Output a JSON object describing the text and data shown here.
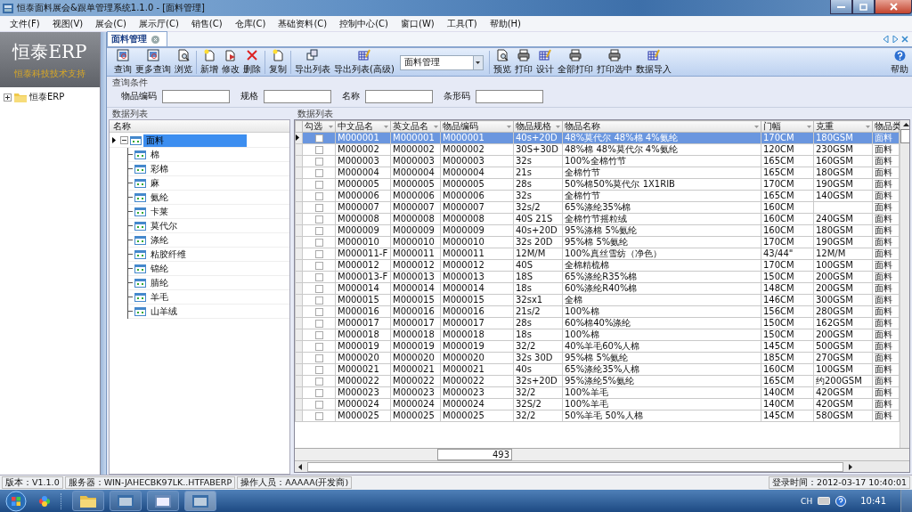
{
  "window": {
    "title": "恒泰面料展会&跟单管理系统1.1.0 - [面料管理]"
  },
  "menu": [
    "文件(F)",
    "视图(V)",
    "展会(C)",
    "展示厅(C)",
    "销售(C)",
    "仓库(C)",
    "基础资料(C)",
    "控制中心(C)",
    "窗口(W)",
    "工具(T)",
    "帮助(H)"
  ],
  "left_panel": {
    "logo": "恒泰ERP",
    "tagline": "恒泰科技技术支持",
    "tree": [
      {
        "label": "恒泰ERP",
        "expanded": false
      }
    ]
  },
  "tabs": [
    {
      "label": "面料管理",
      "selected": true
    }
  ],
  "toolbar": {
    "items": [
      {
        "label": "查询",
        "kind": "query"
      },
      {
        "label": "更多查询",
        "kind": "query"
      },
      {
        "label": "浏览",
        "kind": "preview"
      },
      {
        "label": "新增",
        "kind": "new",
        "group_start": true
      },
      {
        "label": "修改",
        "kind": "edit"
      },
      {
        "label": "删除",
        "kind": "delete"
      },
      {
        "label": "复制",
        "kind": "new",
        "group_start": true
      },
      {
        "label": "导出列表",
        "kind": "export",
        "group_start": true
      },
      {
        "label": "导出列表(高级)",
        "kind": "design"
      },
      {
        "label": "面料管理",
        "kind": "dropdown"
      },
      {
        "label": "预览",
        "kind": "preview",
        "group_start": true
      },
      {
        "label": "打印",
        "kind": "print"
      },
      {
        "label": "设计",
        "kind": "design"
      },
      {
        "label": "全部打印",
        "kind": "print"
      },
      {
        "label": "打印选中",
        "kind": "print"
      },
      {
        "label": "数据导入",
        "kind": "design"
      }
    ],
    "help": "帮助"
  },
  "query": {
    "title": "查询条件",
    "fields": [
      {
        "label": "物品编码"
      },
      {
        "label": "规格"
      },
      {
        "label": "名称"
      },
      {
        "label": "条形码"
      }
    ]
  },
  "category_panel": {
    "title": "数据列表",
    "column": "名称",
    "tree": {
      "label": "面料",
      "expanded": true,
      "selected": true,
      "children": [
        {
          "label": "棉",
          "selected": false
        },
        {
          "label": "彩棉",
          "selected": false
        },
        {
          "label": "麻",
          "selected": false
        },
        {
          "label": "氨纶",
          "selected": false
        },
        {
          "label": "卡莱",
          "selected": false
        },
        {
          "label": "莫代尔",
          "selected": false
        },
        {
          "label": "涤纶",
          "selected": false
        },
        {
          "label": "粘胶纤维",
          "selected": false
        },
        {
          "label": "锦纶",
          "selected": false
        },
        {
          "label": "腈纶",
          "selected": false
        },
        {
          "label": "羊毛",
          "selected": false
        },
        {
          "label": "山羊绒",
          "selected": false
        }
      ]
    }
  },
  "grid": {
    "title": "数据列表",
    "check_column": "勾选",
    "columns": [
      "中文品名",
      "英文品名",
      "物品编码",
      "物品规格",
      "物品名称",
      "门幅",
      "克重",
      "物品类"
    ],
    "rows": [
      {
        "selected": true,
        "checked": false,
        "cells": [
          "M000001",
          "M000001",
          "M000001",
          "40s+20D",
          "48%莫代尔 48%棉 4%氨纶",
          "170CM",
          "180GSM",
          "面料"
        ]
      },
      {
        "selected": false,
        "checked": false,
        "cells": [
          "M000002",
          "M000002",
          "M000002",
          "30S+30D",
          "48%棉 48%莫代尔 4%氨纶",
          "120CM",
          "230GSM",
          "面料"
        ]
      },
      {
        "selected": false,
        "checked": false,
        "cells": [
          "M000003",
          "M000003",
          "M000003",
          "32s",
          "100%全棉竹节",
          "165CM",
          "160GSM",
          "面料"
        ]
      },
      {
        "selected": false,
        "checked": false,
        "cells": [
          "M000004",
          "M000004",
          "M000004",
          "21s",
          "全棉竹节",
          "165CM",
          "180GSM",
          "面料"
        ]
      },
      {
        "selected": false,
        "checked": false,
        "cells": [
          "M000005",
          "M000005",
          "M000005",
          "28s",
          "50%棉50%莫代尔 1X1RIB",
          "170CM",
          "190GSM",
          "面料"
        ]
      },
      {
        "selected": false,
        "checked": false,
        "cells": [
          "M000006",
          "M000006",
          "M000006",
          "32s",
          "全棉竹节",
          "165CM",
          "140GSM",
          "面料"
        ]
      },
      {
        "selected": false,
        "checked": false,
        "cells": [
          "M000007",
          "M000007",
          "M000007",
          "32s/2",
          "65%涤纶35%棉",
          "160CM",
          "",
          "面料"
        ]
      },
      {
        "selected": false,
        "checked": false,
        "cells": [
          "M000008",
          "M000008",
          "M000008",
          "40S 21S",
          "全棉竹节摇粒绒",
          "160CM",
          "240GSM",
          "面料"
        ]
      },
      {
        "selected": false,
        "checked": false,
        "cells": [
          "M000009",
          "M000009",
          "M000009",
          "40s+20D",
          "95%涤棉 5%氨纶",
          "160CM",
          "180GSM",
          "面料"
        ]
      },
      {
        "selected": false,
        "checked": false,
        "cells": [
          "M000010",
          "M000010",
          "M000010",
          "32s 20D",
          "95%棉 5%氨纶",
          "170CM",
          "190GSM",
          "面料"
        ]
      },
      {
        "selected": false,
        "checked": false,
        "cells": [
          "M000011-F",
          "M000011",
          "M000011",
          "12M/M",
          "100%真丝雪纺（净色）",
          "43/44\"",
          "12M/M",
          "面料"
        ]
      },
      {
        "selected": false,
        "checked": false,
        "cells": [
          "M000012",
          "M000012",
          "M000012",
          "40S",
          "全棉精梳棉",
          "170CM",
          "100GSM",
          "面料"
        ]
      },
      {
        "selected": false,
        "checked": false,
        "cells": [
          "M000013-F",
          "M000013",
          "M000013",
          "18S",
          "65%涤纶R35%棉",
          "150CM",
          "200GSM",
          "面料"
        ]
      },
      {
        "selected": false,
        "checked": false,
        "cells": [
          "M000014",
          "M000014",
          "M000014",
          "18s",
          "60%涤纶R40%棉",
          "148CM",
          "200GSM",
          "面料"
        ]
      },
      {
        "selected": false,
        "checked": false,
        "cells": [
          "M000015",
          "M000015",
          "M000015",
          "32sx1",
          "全棉",
          "146CM",
          "300GSM",
          "面料"
        ]
      },
      {
        "selected": false,
        "checked": false,
        "cells": [
          "M000016",
          "M000016",
          "M000016",
          "21s/2",
          "100%棉",
          "156CM",
          "280GSM",
          "面料"
        ]
      },
      {
        "selected": false,
        "checked": false,
        "cells": [
          "M000017",
          "M000017",
          "M000017",
          "28s",
          "60%棉40%涤纶",
          "150CM",
          "162GSM",
          "面料"
        ]
      },
      {
        "selected": false,
        "checked": false,
        "cells": [
          "M000018",
          "M000018",
          "M000018",
          "18s",
          "100%棉",
          "150CM",
          "200GSM",
          "面料"
        ]
      },
      {
        "selected": false,
        "checked": false,
        "cells": [
          "M000019",
          "M000019",
          "M000019",
          "32/2",
          "40%羊毛60%人棉",
          "145CM",
          "500GSM",
          "面料"
        ]
      },
      {
        "selected": false,
        "checked": false,
        "cells": [
          "M000020",
          "M000020",
          "M000020",
          "32s 30D",
          "95%棉 5%氨纶",
          "185CM",
          "270GSM",
          "面料"
        ]
      },
      {
        "selected": false,
        "checked": false,
        "cells": [
          "M000021",
          "M000021",
          "M000021",
          "40s",
          "65%涤纶35%人棉",
          "160CM",
          "100GSM",
          "面料"
        ]
      },
      {
        "selected": false,
        "checked": false,
        "cells": [
          "M000022",
          "M000022",
          "M000022",
          "32s+20D",
          "95%涤纶5%氨纶",
          "165CM",
          "约200GSM",
          "面料"
        ]
      },
      {
        "selected": false,
        "checked": false,
        "cells": [
          "M000023",
          "M000023",
          "M000023",
          "32/2",
          "100%羊毛",
          "140CM",
          "420GSM",
          "面料"
        ]
      },
      {
        "selected": false,
        "checked": false,
        "cells": [
          "M000024",
          "M000024",
          "M000024",
          "32S/2",
          "100%羊毛",
          "140CM",
          "420GSM",
          "面料"
        ]
      },
      {
        "selected": false,
        "checked": false,
        "cells": [
          "M000025",
          "M000025",
          "M000025",
          "32/2",
          "50%羊毛 50%人棉",
          "145CM",
          "580GSM",
          "面料"
        ]
      }
    ],
    "total": "493"
  },
  "status_bar": {
    "items": [
      "版本：V1.1.0",
      "服务器：WIN-JAHECBK97LK..HTFABERP",
      "操作人员：AAAAA(开发商)"
    ],
    "login": "登录时间：2012-03-17 10:40:01"
  },
  "taskbar": {
    "language": "CH",
    "time": "10:41"
  }
}
